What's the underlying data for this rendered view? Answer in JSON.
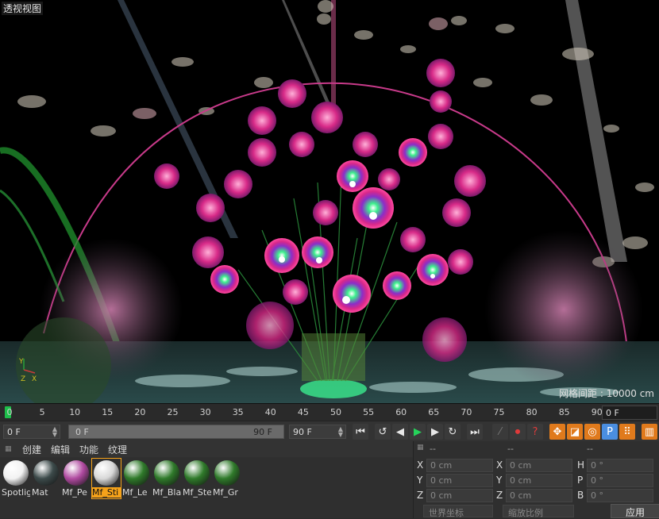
{
  "viewport": {
    "title": "透视视图",
    "grid_spacing": "网格间距 : 10000 cm"
  },
  "timeline": {
    "ticks": [
      "0",
      "5",
      "10",
      "15",
      "20",
      "25",
      "30",
      "35",
      "40",
      "45",
      "50",
      "55",
      "60",
      "65",
      "70",
      "75",
      "80",
      "85",
      "90"
    ],
    "current_frame_field": "0 F"
  },
  "controls": {
    "start_field": "0 F",
    "range_start": "0 F",
    "range_end": "90 F",
    "end_field": "90 F"
  },
  "material_panel": {
    "menu": [
      "创建",
      "编辑",
      "功能",
      "纹理"
    ],
    "materials": [
      {
        "name": "Spotlig",
        "color": "#f2f2f2",
        "selected": false
      },
      {
        "name": "Mat",
        "color": "#3c4a4a",
        "selected": false
      },
      {
        "name": "Mf_Pe",
        "color": "#b04aa0",
        "selected": false
      },
      {
        "name": "Mf_Sti",
        "color": "#d8d8d8",
        "selected": true
      },
      {
        "name": "Mf_Le",
        "color": "#2f7a2a",
        "selected": false
      },
      {
        "name": "Mf_Bla",
        "color": "#2f7a2a",
        "selected": false
      },
      {
        "name": "Mf_Ste",
        "color": "#2f7a2a",
        "selected": false
      },
      {
        "name": "Mf_Gr",
        "color": "#2f7a2a",
        "selected": false
      }
    ]
  },
  "coordinates": {
    "headers": [
      "--",
      "--",
      "--"
    ],
    "rows": [
      {
        "l1": "X",
        "v1": "0 cm",
        "l2": "X",
        "v2": "0 cm",
        "l3": "H",
        "v3": "0 °"
      },
      {
        "l1": "Y",
        "v1": "0 cm",
        "l2": "Y",
        "v2": "0 cm",
        "l3": "P",
        "v3": "0 °"
      },
      {
        "l1": "Z",
        "v1": "0 cm",
        "l2": "Z",
        "v2": "0 cm",
        "l3": "B",
        "v3": "0 °"
      }
    ],
    "world_coords": "世界坐标",
    "scale_ratio": "缩放比例",
    "apply": "应用"
  }
}
